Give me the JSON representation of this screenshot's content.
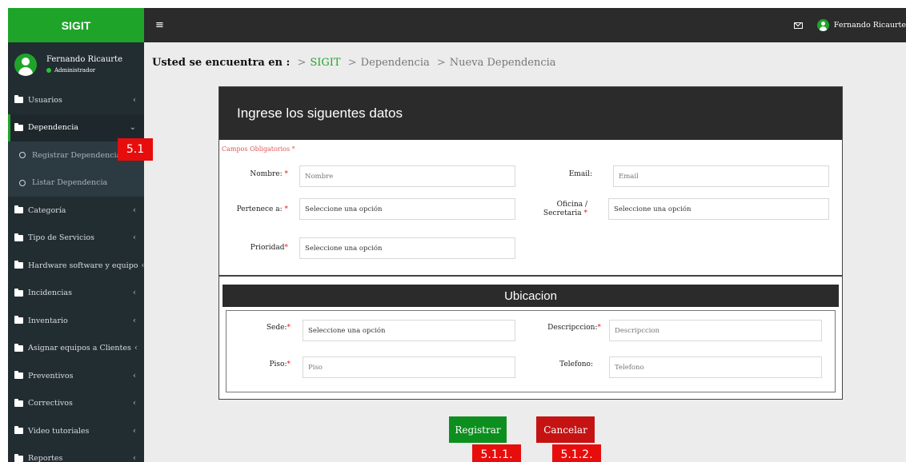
{
  "app": {
    "brand": "SIGIT"
  },
  "user": {
    "name": "Fernando Ricaurte",
    "role": "Administrador"
  },
  "topbar": {
    "menu_icon": "≡",
    "user_name": "Fernando Ricaurte"
  },
  "sidebar": {
    "items": [
      {
        "label": "Usuarios"
      },
      {
        "label": "Dependencia"
      },
      {
        "label": "Categoría"
      },
      {
        "label": "Tipo de Servicios"
      },
      {
        "label": "Hardware software y equipo"
      },
      {
        "label": "Incidencias"
      },
      {
        "label": "Inventario"
      },
      {
        "label": "Asignar equipos a Clientes"
      },
      {
        "label": "Preventivos"
      },
      {
        "label": "Correctivos"
      },
      {
        "label": "Video tutoriales"
      },
      {
        "label": "Reportes"
      }
    ],
    "submenu": [
      {
        "label": "Registrar Dependencia"
      },
      {
        "label": "Listar Dependencia"
      }
    ]
  },
  "breadcrumb": {
    "label": "Usted se encuentra en :",
    "sep": ">",
    "items": [
      "SIGIT",
      "Dependencia",
      "Nueva Dependencia"
    ]
  },
  "form": {
    "header": "Ingrese los siguentes datos",
    "required_note": "Campos Obligatorios",
    "required_mark": "*",
    "nombre": {
      "label": "Nombre:",
      "placeholder": "Nombre"
    },
    "email": {
      "label": "Email:",
      "placeholder": "Email"
    },
    "pertenece": {
      "label": "Pertenece a:",
      "value": "Seleccione una opción"
    },
    "oficina": {
      "label_line1": "Oficina /",
      "label_line2": "Secretaria",
      "value": "Seleccione una opción"
    },
    "prioridad": {
      "label": "Prioridad",
      "value": "Seleccione una opción"
    }
  },
  "ubicacion": {
    "title": "Ubicacion",
    "sede": {
      "label": "Sede:",
      "value": "Seleccione una opción"
    },
    "descripcion": {
      "label": "Descripccion:",
      "placeholder": "Descripccion"
    },
    "piso": {
      "label": "Piso:",
      "placeholder": "Piso"
    },
    "telefono": {
      "label": "Telefono:",
      "placeholder": "Telefono"
    }
  },
  "buttons": {
    "register": "Registrar",
    "cancel": "Cancelar"
  },
  "callouts": {
    "c1": "5.1",
    "c2": "5.1.1.",
    "c3": "5.1.2."
  },
  "colors": {
    "brand_green": "#1fa42a",
    "sidebar": "#222d32",
    "topbar": "#2b2b2b",
    "register": "#0c8f1e",
    "cancel": "#c51313",
    "callout": "#e80d0d"
  }
}
